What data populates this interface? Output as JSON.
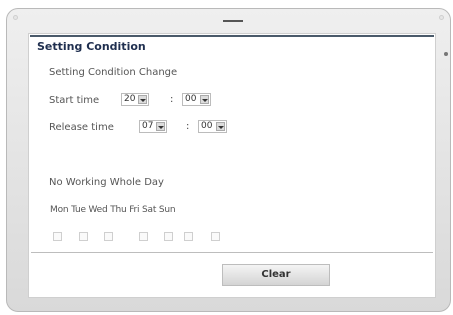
{
  "panel": {
    "title": "Setting Condition",
    "subtitle": "Setting Condition Change",
    "start_label": "Start time",
    "start_hour": "20",
    "start_minute": "00",
    "release_label": "Release time",
    "release_hour": "07",
    "release_minute": "00",
    "colon": ":",
    "no_working_label": "No Working Whole Day",
    "days": [
      "Mon",
      "Tue",
      "Wed",
      "Thu",
      "Fri",
      "Sat",
      "Sun"
    ],
    "clear_label": "Clear"
  }
}
